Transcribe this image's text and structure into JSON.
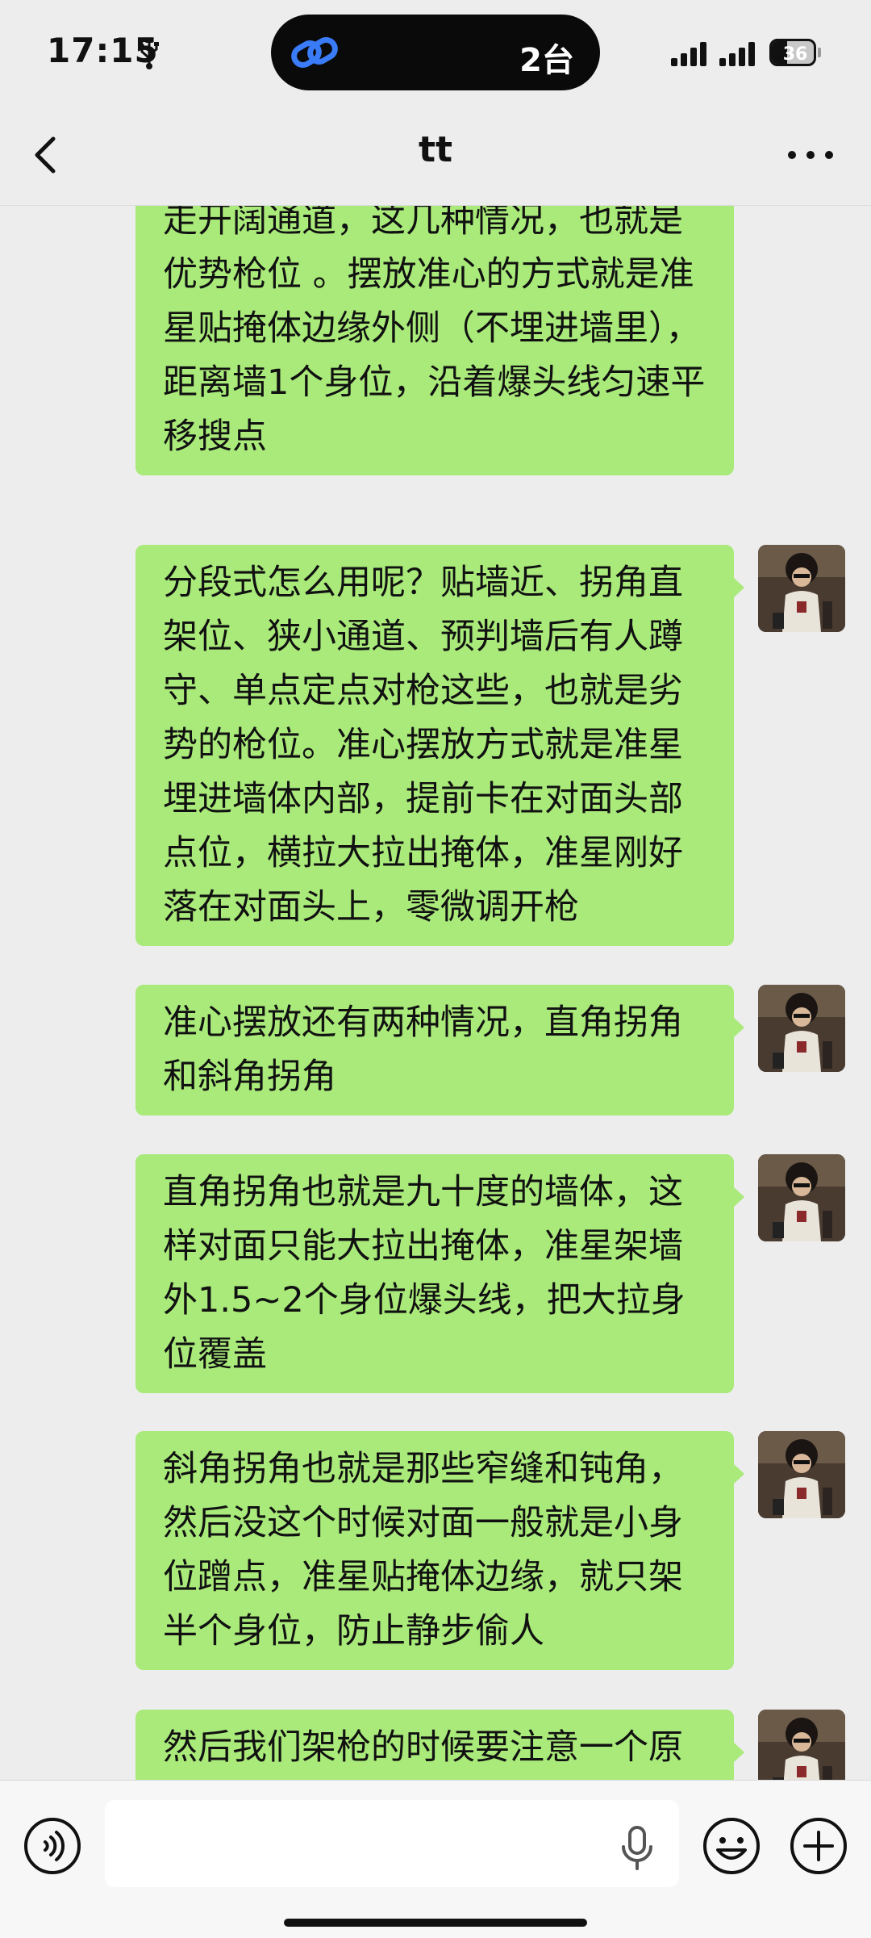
{
  "status_bar": {
    "time": "17:15",
    "island_text": "2台",
    "battery_level": "36",
    "battery_fraction": 0.36
  },
  "nav": {
    "title": "tt",
    "back_icon": "chevron-left-icon",
    "more_icon": "ellipsis-icon"
  },
  "messages": [
    {
      "sender": "me",
      "text": "前压、无直架敌人、大范围搜点、走开阔通道，这几种情况，也就是优势枪位 。摆放准心的方式就是准星贴掩体边缘外侧（不埋进墙里），距离墙1个身位，沿着爆头线匀速平移搜点",
      "partially_scrolled": true
    },
    {
      "sender": "me",
      "text": "分段式怎么用呢？贴墙近、拐角直架位、狭小通道、预判墙后有人蹲守、单点定点对枪这些，也就是劣势的枪位。准心摆放方式就是准星埋进墙体内部，提前卡在对面头部点位，横拉大拉出掩体，准星刚好落在对面头上，零微调开枪"
    },
    {
      "sender": "me",
      "text": "准心摆放还有两种情况，直角拐角和斜角拐角"
    },
    {
      "sender": "me",
      "text": "直角拐角也就是九十度的墙体，这样对面只能大拉出掩体，准星架墙外1.5~2个身位爆头线，把大拉身位覆盖"
    },
    {
      "sender": "me",
      "text": "斜角拐角也就是那些窄缝和钝角，然后没这个时候对面一般就是小身位蹭点，准星贴掩体边缘，就只架半个身位，防止静步偷人"
    },
    {
      "sender": "me",
      "text": "然后我们架枪的时候要注意一个原",
      "partially_scrolled": true
    }
  ],
  "input_bar": {
    "value": "",
    "voice_icon": "voice-icon",
    "mic_icon": "mic-icon",
    "emoji_icon": "emoji-icon",
    "plus_icon": "plus-icon"
  },
  "colors": {
    "background": "#ededed",
    "bubble_self": "#a9ea7a",
    "input_bar": "#f7f7f7"
  }
}
